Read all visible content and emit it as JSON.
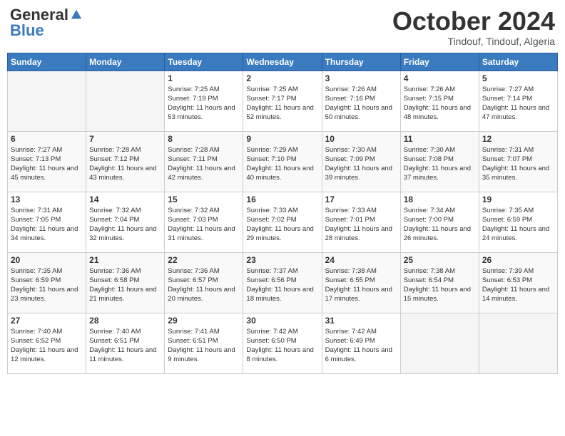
{
  "logo": {
    "general": "General",
    "blue": "Blue"
  },
  "title": "October 2024",
  "location": "Tindouf, Tindouf, Algeria",
  "days_of_week": [
    "Sunday",
    "Monday",
    "Tuesday",
    "Wednesday",
    "Thursday",
    "Friday",
    "Saturday"
  ],
  "weeks": [
    [
      {
        "day": "",
        "empty": true
      },
      {
        "day": "",
        "empty": true
      },
      {
        "day": "1",
        "sunrise": "Sunrise: 7:25 AM",
        "sunset": "Sunset: 7:19 PM",
        "daylight": "Daylight: 11 hours and 53 minutes."
      },
      {
        "day": "2",
        "sunrise": "Sunrise: 7:25 AM",
        "sunset": "Sunset: 7:17 PM",
        "daylight": "Daylight: 11 hours and 52 minutes."
      },
      {
        "day": "3",
        "sunrise": "Sunrise: 7:26 AM",
        "sunset": "Sunset: 7:16 PM",
        "daylight": "Daylight: 11 hours and 50 minutes."
      },
      {
        "day": "4",
        "sunrise": "Sunrise: 7:26 AM",
        "sunset": "Sunset: 7:15 PM",
        "daylight": "Daylight: 11 hours and 48 minutes."
      },
      {
        "day": "5",
        "sunrise": "Sunrise: 7:27 AM",
        "sunset": "Sunset: 7:14 PM",
        "daylight": "Daylight: 11 hours and 47 minutes."
      }
    ],
    [
      {
        "day": "6",
        "sunrise": "Sunrise: 7:27 AM",
        "sunset": "Sunset: 7:13 PM",
        "daylight": "Daylight: 11 hours and 45 minutes."
      },
      {
        "day": "7",
        "sunrise": "Sunrise: 7:28 AM",
        "sunset": "Sunset: 7:12 PM",
        "daylight": "Daylight: 11 hours and 43 minutes."
      },
      {
        "day": "8",
        "sunrise": "Sunrise: 7:28 AM",
        "sunset": "Sunset: 7:11 PM",
        "daylight": "Daylight: 11 hours and 42 minutes."
      },
      {
        "day": "9",
        "sunrise": "Sunrise: 7:29 AM",
        "sunset": "Sunset: 7:10 PM",
        "daylight": "Daylight: 11 hours and 40 minutes."
      },
      {
        "day": "10",
        "sunrise": "Sunrise: 7:30 AM",
        "sunset": "Sunset: 7:09 PM",
        "daylight": "Daylight: 11 hours and 39 minutes."
      },
      {
        "day": "11",
        "sunrise": "Sunrise: 7:30 AM",
        "sunset": "Sunset: 7:08 PM",
        "daylight": "Daylight: 11 hours and 37 minutes."
      },
      {
        "day": "12",
        "sunrise": "Sunrise: 7:31 AM",
        "sunset": "Sunset: 7:07 PM",
        "daylight": "Daylight: 11 hours and 35 minutes."
      }
    ],
    [
      {
        "day": "13",
        "sunrise": "Sunrise: 7:31 AM",
        "sunset": "Sunset: 7:05 PM",
        "daylight": "Daylight: 11 hours and 34 minutes."
      },
      {
        "day": "14",
        "sunrise": "Sunrise: 7:32 AM",
        "sunset": "Sunset: 7:04 PM",
        "daylight": "Daylight: 11 hours and 32 minutes."
      },
      {
        "day": "15",
        "sunrise": "Sunrise: 7:32 AM",
        "sunset": "Sunset: 7:03 PM",
        "daylight": "Daylight: 11 hours and 31 minutes."
      },
      {
        "day": "16",
        "sunrise": "Sunrise: 7:33 AM",
        "sunset": "Sunset: 7:02 PM",
        "daylight": "Daylight: 11 hours and 29 minutes."
      },
      {
        "day": "17",
        "sunrise": "Sunrise: 7:33 AM",
        "sunset": "Sunset: 7:01 PM",
        "daylight": "Daylight: 11 hours and 28 minutes."
      },
      {
        "day": "18",
        "sunrise": "Sunrise: 7:34 AM",
        "sunset": "Sunset: 7:00 PM",
        "daylight": "Daylight: 11 hours and 26 minutes."
      },
      {
        "day": "19",
        "sunrise": "Sunrise: 7:35 AM",
        "sunset": "Sunset: 6:59 PM",
        "daylight": "Daylight: 11 hours and 24 minutes."
      }
    ],
    [
      {
        "day": "20",
        "sunrise": "Sunrise: 7:35 AM",
        "sunset": "Sunset: 6:59 PM",
        "daylight": "Daylight: 11 hours and 23 minutes."
      },
      {
        "day": "21",
        "sunrise": "Sunrise: 7:36 AM",
        "sunset": "Sunset: 6:58 PM",
        "daylight": "Daylight: 11 hours and 21 minutes."
      },
      {
        "day": "22",
        "sunrise": "Sunrise: 7:36 AM",
        "sunset": "Sunset: 6:57 PM",
        "daylight": "Daylight: 11 hours and 20 minutes."
      },
      {
        "day": "23",
        "sunrise": "Sunrise: 7:37 AM",
        "sunset": "Sunset: 6:56 PM",
        "daylight": "Daylight: 11 hours and 18 minutes."
      },
      {
        "day": "24",
        "sunrise": "Sunrise: 7:38 AM",
        "sunset": "Sunset: 6:55 PM",
        "daylight": "Daylight: 11 hours and 17 minutes."
      },
      {
        "day": "25",
        "sunrise": "Sunrise: 7:38 AM",
        "sunset": "Sunset: 6:54 PM",
        "daylight": "Daylight: 11 hours and 15 minutes."
      },
      {
        "day": "26",
        "sunrise": "Sunrise: 7:39 AM",
        "sunset": "Sunset: 6:53 PM",
        "daylight": "Daylight: 11 hours and 14 minutes."
      }
    ],
    [
      {
        "day": "27",
        "sunrise": "Sunrise: 7:40 AM",
        "sunset": "Sunset: 6:52 PM",
        "daylight": "Daylight: 11 hours and 12 minutes."
      },
      {
        "day": "28",
        "sunrise": "Sunrise: 7:40 AM",
        "sunset": "Sunset: 6:51 PM",
        "daylight": "Daylight: 11 hours and 11 minutes."
      },
      {
        "day": "29",
        "sunrise": "Sunrise: 7:41 AM",
        "sunset": "Sunset: 6:51 PM",
        "daylight": "Daylight: 11 hours and 9 minutes."
      },
      {
        "day": "30",
        "sunrise": "Sunrise: 7:42 AM",
        "sunset": "Sunset: 6:50 PM",
        "daylight": "Daylight: 11 hours and 8 minutes."
      },
      {
        "day": "31",
        "sunrise": "Sunrise: 7:42 AM",
        "sunset": "Sunset: 6:49 PM",
        "daylight": "Daylight: 11 hours and 6 minutes."
      },
      {
        "day": "",
        "empty": true
      },
      {
        "day": "",
        "empty": true
      }
    ]
  ]
}
